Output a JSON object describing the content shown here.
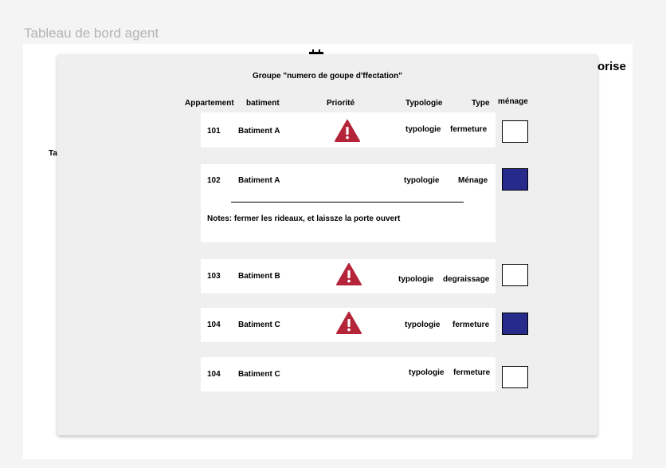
{
  "page": {
    "title": "Tableau de bord agent"
  },
  "background": {
    "label_right": "orise",
    "label_left": "Ta"
  },
  "modal": {
    "title": "Groupe \"numero de goupe d'ffectation\"",
    "headers": {
      "appartement": "Appartement",
      "batiment": "batiment",
      "priorite": "Priorité",
      "typologie": "Typologie",
      "type": "Type",
      "menage": "ménage"
    },
    "rows": [
      {
        "appartement": "101",
        "batiment": "Batiment A",
        "priority": true,
        "typologie": "typologie",
        "type": "fermeture",
        "menage": false
      },
      {
        "appartement": "102",
        "batiment": "Batiment A",
        "priority": false,
        "typologie": "typologie",
        "type": "Ménage",
        "menage": true,
        "notes": "Notes: fermer les rideaux, et laissze la porte ouvert"
      },
      {
        "appartement": "103",
        "batiment": "Batiment B",
        "priority": true,
        "typologie": "typologie",
        "type": "degraissage",
        "menage": false
      },
      {
        "appartement": "104",
        "batiment": "Batiment C",
        "priority": true,
        "typologie": "typologie",
        "type": "fermeture",
        "menage": true
      },
      {
        "appartement": "104",
        "batiment": "Batiment C",
        "priority": false,
        "typologie": "typologie",
        "type": "fermeture",
        "menage": false
      }
    ]
  },
  "colors": {
    "priority_icon": "#b5253a",
    "checkbox_checked": "#252a8b",
    "modal_background": "#efefef"
  },
  "icons": {
    "priority": "warning-triangle-icon",
    "background_header": "calendar-icon"
  }
}
